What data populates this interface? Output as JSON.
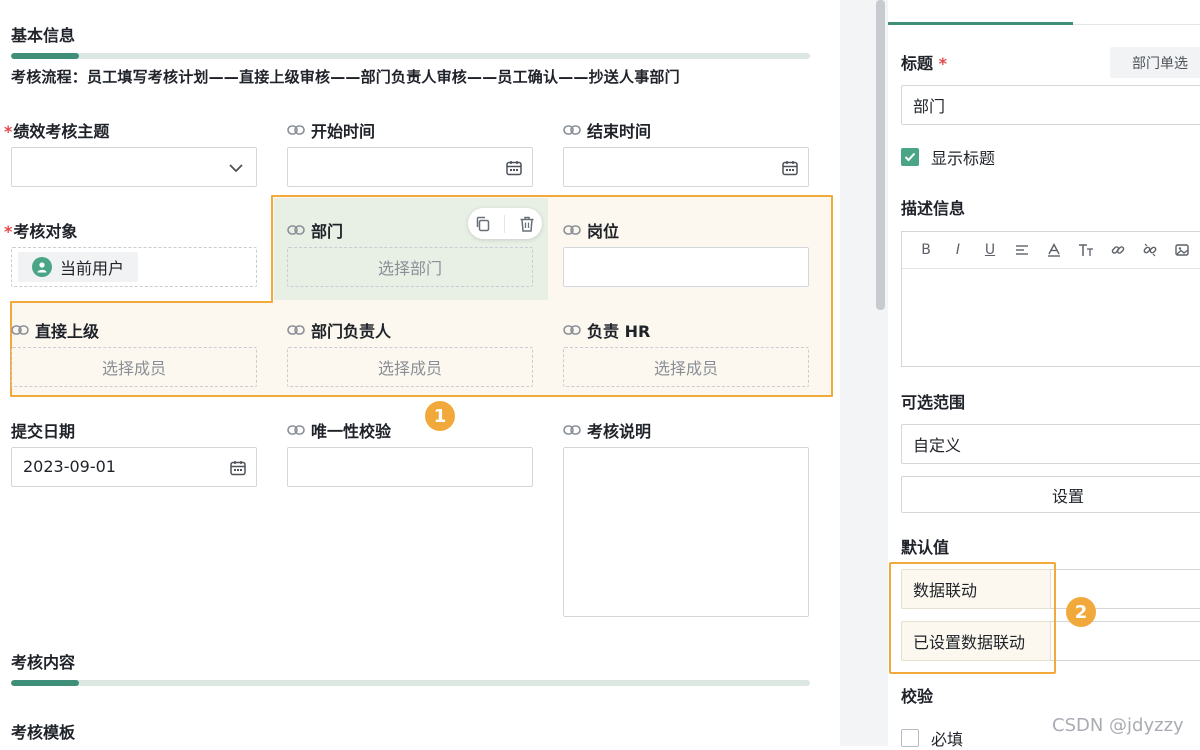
{
  "left": {
    "basic_info_title": "基本信息",
    "flow_text": "考核流程：员工填写考核计划——直接上级审核——部门负责人审核——员工确认——抄送人事部门",
    "fields": {
      "theme": {
        "label": "绩效考核主题",
        "required": "*"
      },
      "start_time": {
        "label": "开始时间"
      },
      "end_time": {
        "label": "结束时间"
      },
      "target": {
        "label": "考核对象",
        "required": "*",
        "value": "当前用户"
      },
      "dept": {
        "label": "部门",
        "placeholder": "选择部门"
      },
      "position": {
        "label": "岗位"
      },
      "direct_superior": {
        "label": "直接上级",
        "placeholder": "选择成员"
      },
      "dept_head": {
        "label": "部门负责人",
        "placeholder": "选择成员"
      },
      "hr": {
        "label": "负责 HR",
        "placeholder": "选择成员"
      },
      "submit_date": {
        "label": "提交日期",
        "value": "2023-09-01"
      },
      "uniqueness": {
        "label": "唯一性校验"
      },
      "description": {
        "label": "考核说明"
      }
    },
    "badge_1": "1",
    "content_title": "考核内容",
    "template_title": "考核模板"
  },
  "right": {
    "title_label": "标题",
    "title_required": "*",
    "type_chip": "部门单选",
    "title_value": "部门",
    "show_title_label": "显示标题",
    "description_label": "描述信息",
    "toolbar": [
      "B",
      "I",
      "U"
    ],
    "range_label": "可选范围",
    "range_value": "自定义",
    "settings_button": "设置",
    "default_label": "默认值",
    "default_option_1": "数据联动",
    "default_option_2": "已设置数据联动",
    "badge_2": "2",
    "validation_label": "校验",
    "required_label": "必填"
  },
  "watermark": "CSDN @jdyzzy",
  "colors": {
    "accent": "#3f8f78",
    "orange": "#f2a93b",
    "required": "#e5484d",
    "highlight_bg": "#fcf8ef"
  }
}
